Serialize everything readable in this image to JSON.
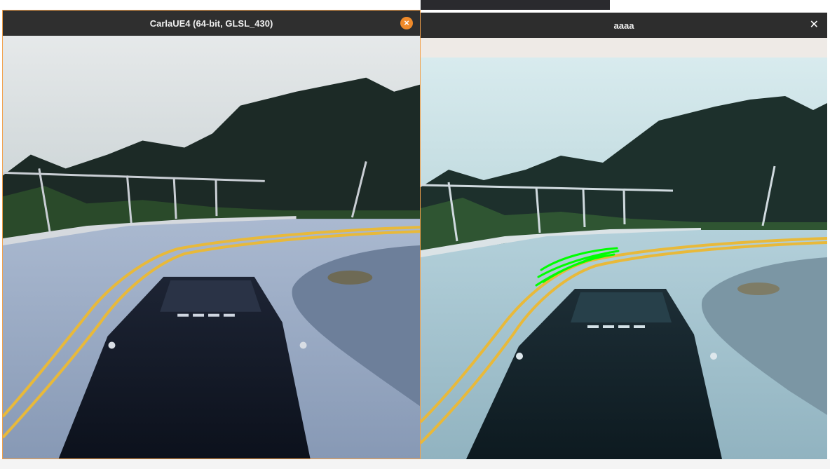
{
  "windows": {
    "left": {
      "title": "CarlaUE4 (64-bit, GLSL_430)",
      "close_icon": "close-circle-icon"
    },
    "right": {
      "title": "aaaa",
      "close_icon": "close-icon"
    }
  },
  "colors": {
    "active_border": "#f2a04a",
    "close_button": "#ef8a2a",
    "lane_overlay": "#00ff00",
    "road_line": "#e8b93a"
  }
}
